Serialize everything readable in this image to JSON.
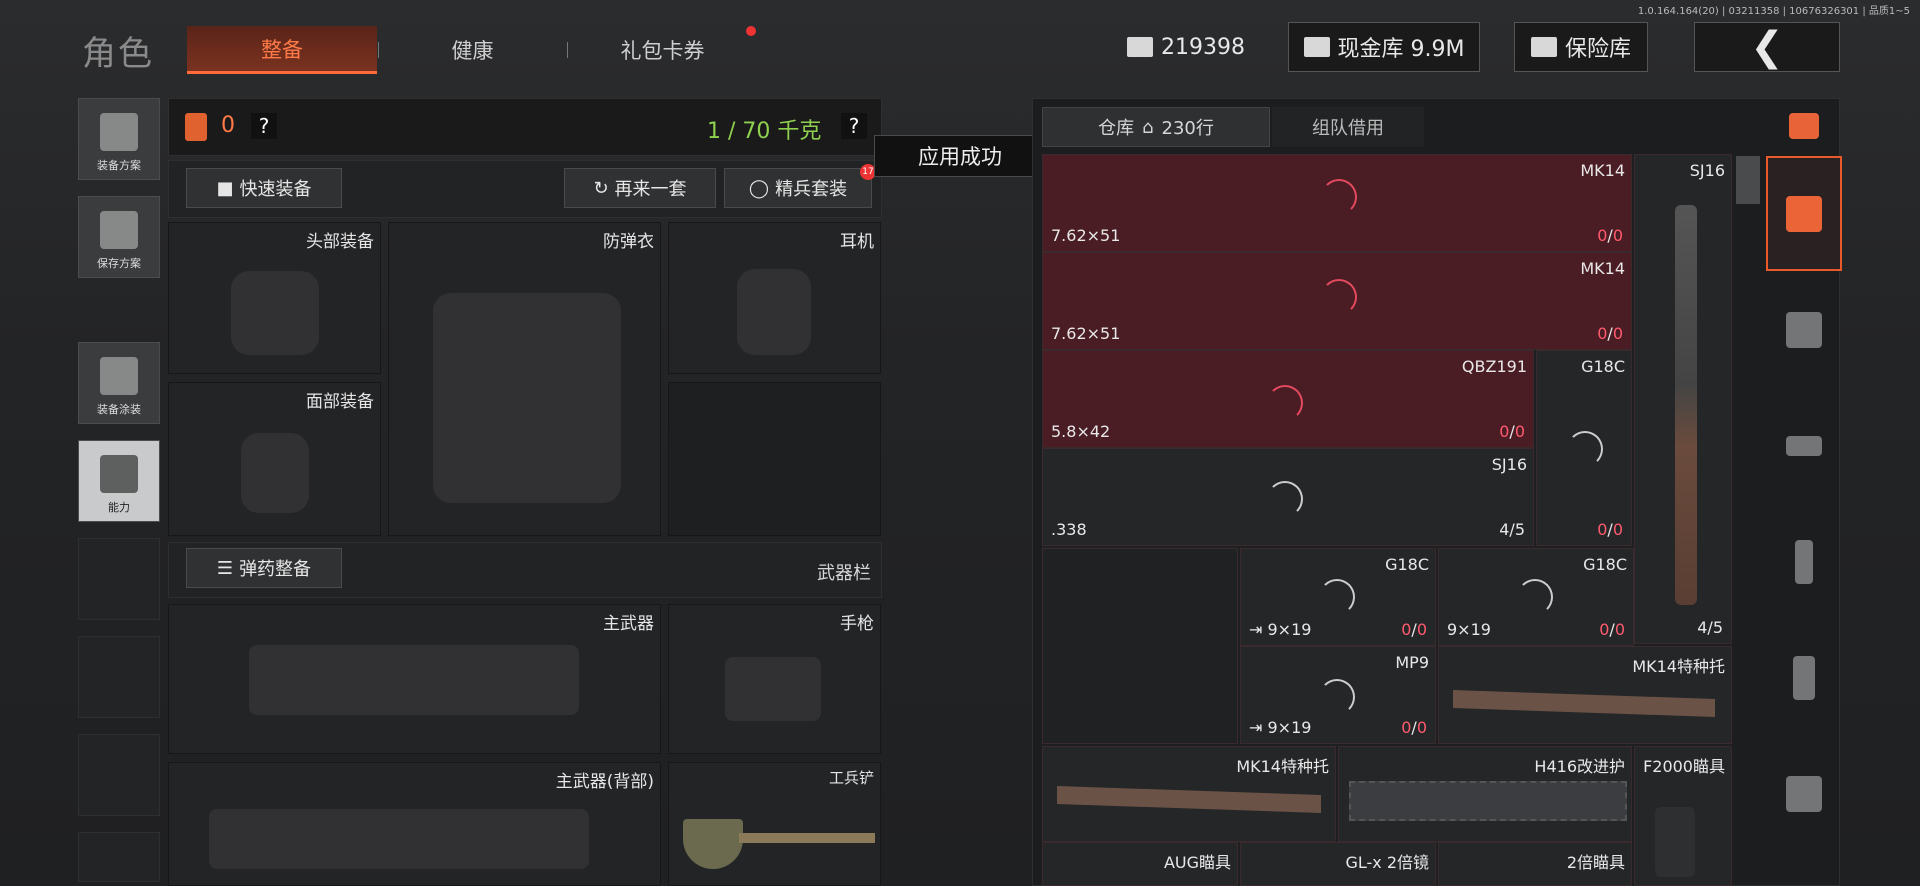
{
  "version": "1.0.164.164(20) | 03211358 | 10676326301 | 品质1~5",
  "title": "角色",
  "tabs": [
    {
      "label": "整备"
    },
    {
      "label": "健康"
    },
    {
      "label": "礼包卡券"
    }
  ],
  "top": {
    "money": "219398",
    "cash_vault": "现金库 9.9M",
    "safe": "保险库",
    "back_icon": "chevron-left-icon"
  },
  "side": [
    {
      "label": "装备方案"
    },
    {
      "label": "保存方案"
    },
    {
      "label": "装备涂装"
    },
    {
      "label": "能力"
    }
  ],
  "loadout": {
    "armor_count": "0",
    "help": "?",
    "weight": "1 / 70 千克",
    "weight_help": "?",
    "quick_equip": "快速装备",
    "again": "再来一套",
    "elite": "精兵套装",
    "elite_badge": "17",
    "slots": {
      "head": "头部装备",
      "vest": "防弹衣",
      "headset": "耳机",
      "face": "面部装备",
      "primary": "主武器",
      "pistol": "手枪",
      "primary_back": "主武器(背部)",
      "shovel": "工兵铲"
    },
    "ammo_btn": "弹药整备",
    "weapon_bar": "武器栏"
  },
  "toast": "应用成功",
  "storage": {
    "tab_storage": "仓库",
    "tab_rows": "230行",
    "tab_team": "组队借用",
    "items": [
      {
        "name": "MK14",
        "caliber": "7.62×51",
        "count_a": "0",
        "count_b": "0"
      },
      {
        "name": "MK14",
        "caliber": "7.62×51",
        "count_a": "0",
        "count_b": "0"
      },
      {
        "name": "QBZ191",
        "caliber": "5.8×42",
        "count_a": "0",
        "count_b": "0"
      },
      {
        "name": "SJ16",
        "caliber": ".338",
        "count_a": "4",
        "count_b": "5"
      },
      {
        "name": "G18C",
        "caliber": "",
        "count_a": "0",
        "count_b": "0"
      },
      {
        "name": "G18C",
        "caliber": "9×19",
        "count_a": "0",
        "count_b": "0"
      },
      {
        "name": "G18C",
        "caliber": "9×19",
        "count_a": "0",
        "count_b": "0"
      },
      {
        "name": "MP9",
        "caliber": "9×19",
        "count_a": "0",
        "count_b": "0"
      },
      {
        "name": "SJ16",
        "caliber": "",
        "count_a": "4",
        "count_b": "5"
      },
      {
        "name": "MK14特种托"
      },
      {
        "name": "MK14特种托"
      },
      {
        "name": "H416改进护"
      },
      {
        "name": "F2000瞄具"
      },
      {
        "name": "AUG瞄具"
      },
      {
        "name": "GL-x 2倍镜"
      },
      {
        "name": "2倍瞄具"
      }
    ]
  }
}
